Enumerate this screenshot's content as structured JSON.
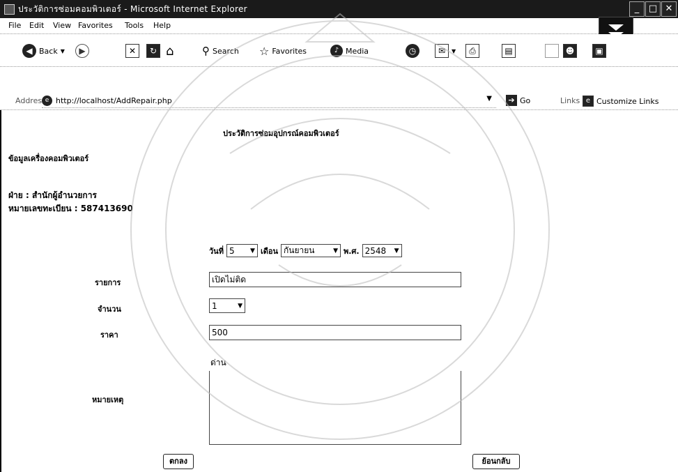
{
  "window": {
    "title": "ประวัติการซ่อมคอมพิวเตอร์ - Microsoft Internet Explorer",
    "buttons": {
      "minimize": "_",
      "maximize": "□",
      "close": "✕"
    }
  },
  "menu": [
    "File",
    "Edit",
    "View",
    "Favorites",
    "Tools",
    "Help"
  ],
  "toolbar": {
    "back_label": "Back",
    "search_label": "Search",
    "favorites_label": "Favorites",
    "media_label": "Media"
  },
  "address": {
    "label": "Address",
    "url": "http://localhost/AddRepair.php",
    "go_label": "Go",
    "links_label": "Links",
    "customize_label": "Customize Links"
  },
  "page": {
    "heading": "ประวัติการซ่อมอุปกรณ์คอมพิวเตอร์",
    "section_title": "ข้อมูลเครื่องคอมพิวเตอร์",
    "department": "ฝ่าย : สำนักผู้อำนวยการ",
    "serial": "หมายเลขทะเบียน : 587413690",
    "date": {
      "day_label": "วันที่",
      "day_value": "5",
      "month_label": "เดือน",
      "month_value": "กันยายน",
      "year_label": "พ.ศ.",
      "year_value": "2548"
    },
    "item_label": "รายการ",
    "item_value": "เปิดไม่ติด",
    "qty_label": "จำนวน",
    "qty_value": "1",
    "price_label": "ราคา",
    "price_value": "500",
    "location_text": "ด่าน",
    "note_label": "หมายเหตุ",
    "save_label": "ตกลง",
    "back_label": "ย้อนกลับ"
  }
}
